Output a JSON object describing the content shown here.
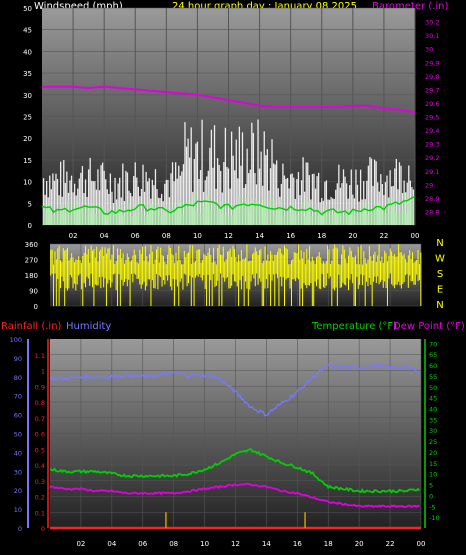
{
  "title": "24 hour graph day : January 08 2025",
  "colors": {
    "wind": "#ffffff",
    "gust": "#cfcfcf",
    "wind_avg": "#00d000",
    "wind_avg_light": "#b8f0b8",
    "barometer": "#e000e0",
    "direction": "#ffff00",
    "humidity": "#7878ff",
    "temperature": "#00d000",
    "dew_point": "#e000e0",
    "rainfall": "#ff2020",
    "rain_rate": "#c8a000",
    "title_color": "#ffff00"
  },
  "chart_data": [
    {
      "type": "line",
      "panel": "wind-barometer",
      "ylabel_left": "Windspeed (mph)",
      "ylabel_right": "Barometer (.in)",
      "x_ticks": [
        "02",
        "04",
        "06",
        "08",
        "10",
        "12",
        "14",
        "16",
        "18",
        "20",
        "22",
        "00"
      ],
      "y_left_range": [
        0,
        50
      ],
      "y_left_ticks": [
        0,
        5,
        10,
        15,
        20,
        25,
        30,
        35,
        40,
        45,
        50
      ],
      "y_right_range": [
        28.7,
        30.3
      ],
      "y_right_ticks": [
        "28.8",
        "28.9",
        "29",
        "29.1",
        "29.2",
        "29.3",
        "29.4",
        "29.5",
        "29.6",
        "29.7",
        "29.8",
        "29.9",
        "30",
        "30.1",
        "30.2"
      ],
      "series": [
        {
          "axis": "right",
          "hours": [
            0,
            1,
            2,
            3,
            4,
            5,
            6,
            7,
            8,
            9,
            10,
            11,
            12,
            13,
            14,
            15,
            16,
            17,
            18,
            19,
            20,
            21,
            22,
            23,
            24
          ],
          "values": [
            29.72,
            29.72,
            29.72,
            29.71,
            29.72,
            29.71,
            29.7,
            29.69,
            29.68,
            29.67,
            29.66,
            29.64,
            29.62,
            29.6,
            29.58,
            29.57,
            29.57,
            29.57,
            29.57,
            29.57,
            29.58,
            29.58,
            29.56,
            29.55,
            29.53
          ]
        },
        {
          "axis": "left",
          "hours": [
            0,
            1,
            2,
            3,
            4,
            5,
            6,
            7,
            8,
            9,
            10,
            11,
            12,
            13,
            14,
            15,
            16,
            17,
            18,
            19,
            20,
            21,
            22,
            23,
            24
          ],
          "values": [
            4,
            3,
            4,
            4,
            3,
            3,
            4,
            4,
            3,
            4,
            5,
            5,
            4,
            5,
            5,
            4,
            4,
            4,
            3,
            3,
            3,
            4,
            4,
            5,
            6
          ]
        }
      ]
    },
    {
      "type": "line",
      "panel": "wind-direction",
      "x_ticks": [
        "02",
        "04",
        "06",
        "08",
        "10",
        "12",
        "14",
        "16",
        "18",
        "20",
        "22",
        "00"
      ],
      "y_range": [
        0,
        360
      ],
      "y_ticks": [
        0,
        90,
        180,
        270,
        360
      ],
      "compass": [
        "N",
        "W",
        "S",
        "E",
        "N"
      ]
    },
    {
      "type": "line",
      "panel": "temp-humidity-rain",
      "label_rainfall": "Rainfall (.in)",
      "label_humidity": "Humidity",
      "label_temperature": "Temperature (°F)",
      "label_dewpoint": "Dew Point (°F)",
      "x_ticks": [
        "02",
        "04",
        "06",
        "08",
        "10",
        "12",
        "14",
        "16",
        "18",
        "20",
        "22",
        "00"
      ],
      "humidity_range": [
        0,
        100
      ],
      "humidity_ticks": [
        0,
        10,
        20,
        30,
        40,
        50,
        60,
        70,
        80,
        90,
        100
      ],
      "rain_range": [
        0,
        1.2
      ],
      "rain_ticks": [
        "0",
        "0.1",
        "0.2",
        "0.3",
        "0.4",
        "0.5",
        "0.6",
        "0.7",
        "0.8",
        "0.9",
        "1",
        "1.1"
      ],
      "temp_range": [
        -15,
        72
      ],
      "temp_ticks": [
        -10,
        -5,
        0,
        5,
        10,
        15,
        20,
        25,
        30,
        35,
        40,
        45,
        50,
        55,
        60,
        65,
        70
      ],
      "series": [
        {
          "name": "Humidity",
          "hours": [
            0,
            1,
            2,
            3,
            4,
            5,
            6,
            7,
            8,
            9,
            10,
            11,
            12,
            13,
            14,
            15,
            16,
            17,
            18,
            19,
            20,
            21,
            22,
            23,
            24
          ],
          "values": [
            79,
            79,
            80,
            80,
            80,
            81,
            80,
            81,
            82,
            81,
            81,
            79,
            72,
            64,
            60,
            66,
            72,
            80,
            86,
            85,
            85,
            86,
            85,
            85,
            83
          ]
        },
        {
          "name": "Temperature (°F)",
          "hours": [
            0,
            1,
            2,
            3,
            4,
            5,
            6,
            7,
            8,
            9,
            10,
            11,
            12,
            13,
            14,
            15,
            16,
            17,
            18,
            19,
            20,
            21,
            22,
            23,
            24
          ],
          "values": [
            12,
            11,
            11,
            11,
            10,
            9,
            9,
            9,
            9,
            10,
            12,
            15,
            19,
            21,
            18,
            15,
            13,
            10,
            4,
            3,
            2,
            2,
            2,
            2,
            3
          ]
        },
        {
          "name": "Dew Point (°F)",
          "hours": [
            0,
            1,
            2,
            3,
            4,
            5,
            6,
            7,
            8,
            9,
            10,
            11,
            12,
            13,
            14,
            15,
            16,
            17,
            18,
            19,
            20,
            21,
            22,
            23,
            24
          ],
          "values": [
            4,
            3,
            3,
            2,
            2,
            1,
            1,
            1,
            1,
            2,
            3,
            4,
            5,
            5,
            4,
            2,
            1,
            -1,
            -3,
            -4,
            -5,
            -5,
            -5,
            -5,
            -5
          ]
        },
        {
          "name": "Rainfall (.in)",
          "hours": [
            0,
            24
          ],
          "values": [
            0,
            0
          ]
        },
        {
          "name": "rain-rate",
          "hours": [
            7.5,
            16.5
          ],
          "values": [
            0.1,
            0.1
          ]
        }
      ]
    }
  ]
}
